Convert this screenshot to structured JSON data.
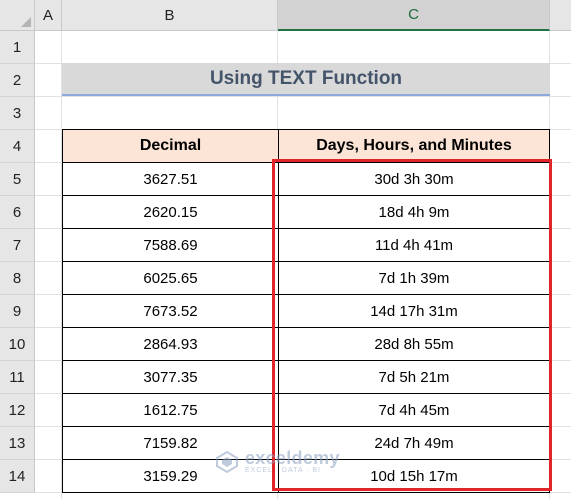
{
  "sheet": {
    "select_all_label": "",
    "columns": [
      "A",
      "B",
      "C"
    ],
    "selected_column": "C",
    "rows": [
      "1",
      "2",
      "3",
      "4",
      "5",
      "6",
      "7",
      "8",
      "9",
      "10",
      "11",
      "12",
      "13",
      "14"
    ]
  },
  "title": "Using TEXT Function",
  "table": {
    "headers": [
      "Decimal",
      "Days, Hours, and Minutes"
    ],
    "rows": [
      [
        "3627.51",
        "30d 3h 30m"
      ],
      [
        "2620.15",
        "18d 4h 9m"
      ],
      [
        "7588.69",
        "11d 4h 41m"
      ],
      [
        "6025.65",
        "7d 1h 39m"
      ],
      [
        "7673.52",
        "14d 17h 31m"
      ],
      [
        "2864.93",
        "28d 8h 55m"
      ],
      [
        "3077.35",
        "7d 5h 21m"
      ],
      [
        "1612.75",
        "7d 4h 45m"
      ],
      [
        "7159.82",
        "24d 7h 49m"
      ],
      [
        "3159.29",
        "10d 15h 17m"
      ]
    ]
  },
  "watermark": {
    "name": "exceldemy",
    "tagline": "EXCEL · DATA · BI",
    "icon": "exceldemy-logo-icon"
  },
  "colors": {
    "header_fill": "#fce4d6",
    "title_fill": "#d9d9d9",
    "highlight_border": "#e0262b",
    "selected_header": "#217346"
  }
}
